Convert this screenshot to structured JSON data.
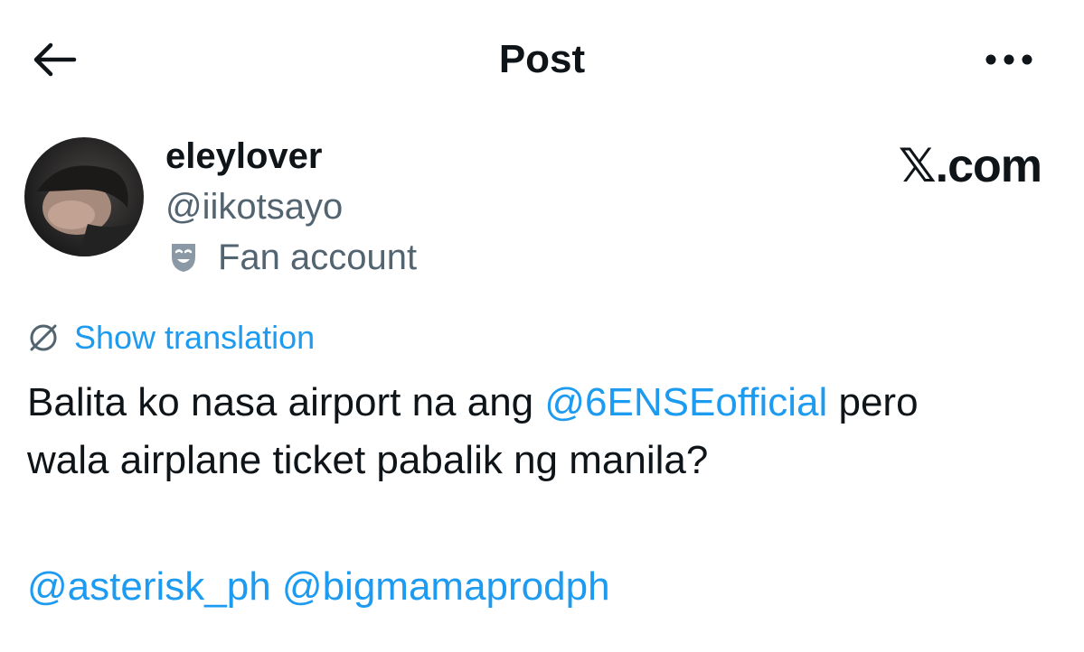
{
  "header": {
    "title": "Post",
    "back_icon": "arrow-left-icon",
    "more_icon": "more-horizontal-icon"
  },
  "author": {
    "display_name": "eleylover",
    "handle": "@iikotsayo",
    "label": "Fan account",
    "label_icon": "theater-mask-icon"
  },
  "brand": {
    "text": "𝕏.com"
  },
  "translation": {
    "label": "Show translation",
    "icon": "globe-slash-icon"
  },
  "post": {
    "line1_before": "Balita ko nasa airport na ang ",
    "mention1": "@6ENSEofficial",
    "line1_after": " pero",
    "line2": "wala airplane ticket pabalik ng manila?",
    "mentions": [
      "@asterisk_ph",
      "@bigmamaprodph"
    ]
  },
  "colors": {
    "accent": "#1d9bf0",
    "text": "#0f1419",
    "secondary": "#536471",
    "background": "#ffffff"
  }
}
